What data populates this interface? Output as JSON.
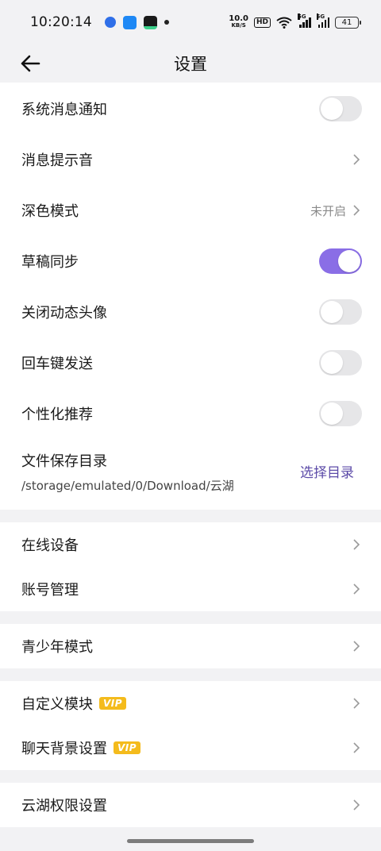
{
  "status": {
    "time": "10:20:14",
    "net_speed": "10.0",
    "net_unit": "KB/S",
    "hd": "HD",
    "sig1_label": "5G",
    "sig2_label": "5G",
    "battery": "41"
  },
  "nav": {
    "title": "设置"
  },
  "group1": {
    "system_notify": {
      "label": "系统消息通知",
      "enabled": false
    },
    "notify_sound": {
      "label": "消息提示音"
    },
    "dark_mode": {
      "label": "深色模式",
      "value": "未开启"
    },
    "draft_sync": {
      "label": "草稿同步",
      "enabled": true
    },
    "close_avatar": {
      "label": "关闭动态头像",
      "enabled": false
    },
    "enter_send": {
      "label": "回车键发送",
      "enabled": false
    },
    "personal_rec": {
      "label": "个性化推荐",
      "enabled": false
    },
    "file_save": {
      "label": "文件保存目录",
      "path": "/storage/emulated/0/Download/云湖",
      "action": "选择目录"
    }
  },
  "group2": {
    "online_devices": {
      "label": "在线设备"
    },
    "account_manage": {
      "label": "账号管理"
    }
  },
  "group3": {
    "youth_mode": {
      "label": "青少年模式"
    }
  },
  "group4": {
    "custom_module": {
      "label": "自定义模块",
      "badge": "VIP"
    },
    "chat_bg": {
      "label": "聊天背景设置",
      "badge": "VIP"
    }
  },
  "group5": {
    "permissions": {
      "label": "云湖权限设置"
    }
  },
  "colors": {
    "accent": "#8a6ee6",
    "link": "#5c4ba8",
    "vip": "#f4bb1c"
  }
}
